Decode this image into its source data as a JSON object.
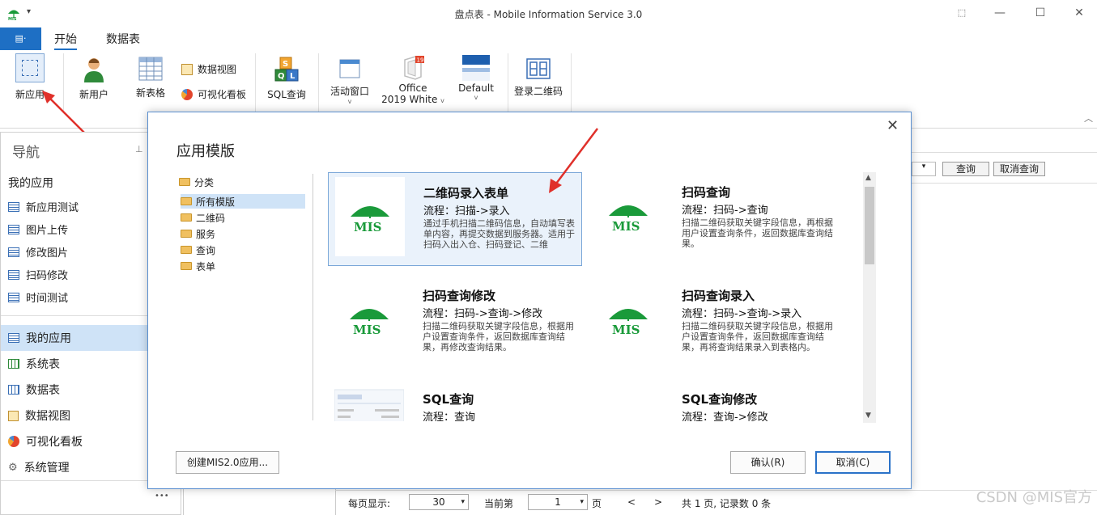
{
  "window": {
    "title": "盘点表 - Mobile Information Service 3.0",
    "dropdown_glyph": "▾",
    "controls": {
      "restore": "⬚",
      "minimize": "—",
      "maximize": "☐",
      "close": "✕"
    }
  },
  "ribbon_tabs": {
    "file_label": "▤·",
    "tabs": [
      "开始",
      "数据表"
    ]
  },
  "ribbon": {
    "new_app": "新应用",
    "new_user": "新用户",
    "new_table": "新表格",
    "data_view": "数据视图",
    "dashboard": "可视化看板",
    "sql_query": "SQL查询",
    "active_window": "活动窗口",
    "theme_office_line1": "Office",
    "theme_office_line2": "2019 White",
    "theme_default": "Default",
    "login_qr": "登录二维码",
    "collapse_glyph": "︿"
  },
  "nav": {
    "title": "导航",
    "pin": "⊥",
    "section": "我的应用",
    "items": [
      "新应用测试",
      "图片上传",
      "修改图片",
      "扫码修改",
      "时间测试"
    ],
    "groups": [
      "我的应用",
      "系统表",
      "数据表",
      "数据视图",
      "可视化看板",
      "系统管理"
    ],
    "more": "•••"
  },
  "main": {
    "query_button": "查询",
    "cancel_query_button": "取消查询",
    "page_size_label": "每页显示:",
    "page_size_value": "30",
    "current_label": "当前第",
    "current_value": "1",
    "page_unit": "页",
    "prev": "<",
    "next": ">",
    "summary": "共 1 页, 记录数 0 条"
  },
  "dialog": {
    "title": "应用模版",
    "close": "✕",
    "tree": [
      "分类",
      "所有模版",
      "二维码",
      "服务",
      "查询",
      "表单"
    ],
    "cards": [
      {
        "title": "二维码录入表单",
        "flow": "流程：扫描->录入",
        "desc": "通过手机扫描二维码信息，自动填写表单内容，再提交数据到服务器。适用于扫码入出入仓、扫码登记、二维"
      },
      {
        "title": "扫码查询",
        "flow": "流程：扫码->查询",
        "desc": "扫描二维码获取关键字段信息，再根据用户设置查询条件，返回数据库查询结果。"
      },
      {
        "title": "扫码查询修改",
        "flow": "流程：扫码->查询->修改",
        "desc": "扫描二维码获取关键字段信息，根据用户设置查询条件，返回数据库查询结果，再修改查询结果。"
      },
      {
        "title": "扫码查询录入",
        "flow": "流程：扫码->查询->录入",
        "desc": "扫描二维码获取关键字段信息，根据用户设置查询条件，返回数据库查询结果，再将查询结果录入到表格内。"
      },
      {
        "title": "SQL查询",
        "flow": "流程：查询",
        "desc": ""
      },
      {
        "title": "SQL查询修改",
        "flow": "流程：查询->修改",
        "desc": ""
      }
    ],
    "logo_text": "MIS",
    "create_button": "创建MIS2.0应用...",
    "ok_button": "确认(R)",
    "cancel_button": "取消(C)"
  },
  "watermark": "CSDN @MIS官方",
  "colors": {
    "accent": "#1e6fc4",
    "logo_green": "#1a9a3a",
    "arrow_red": "#e0302a"
  }
}
